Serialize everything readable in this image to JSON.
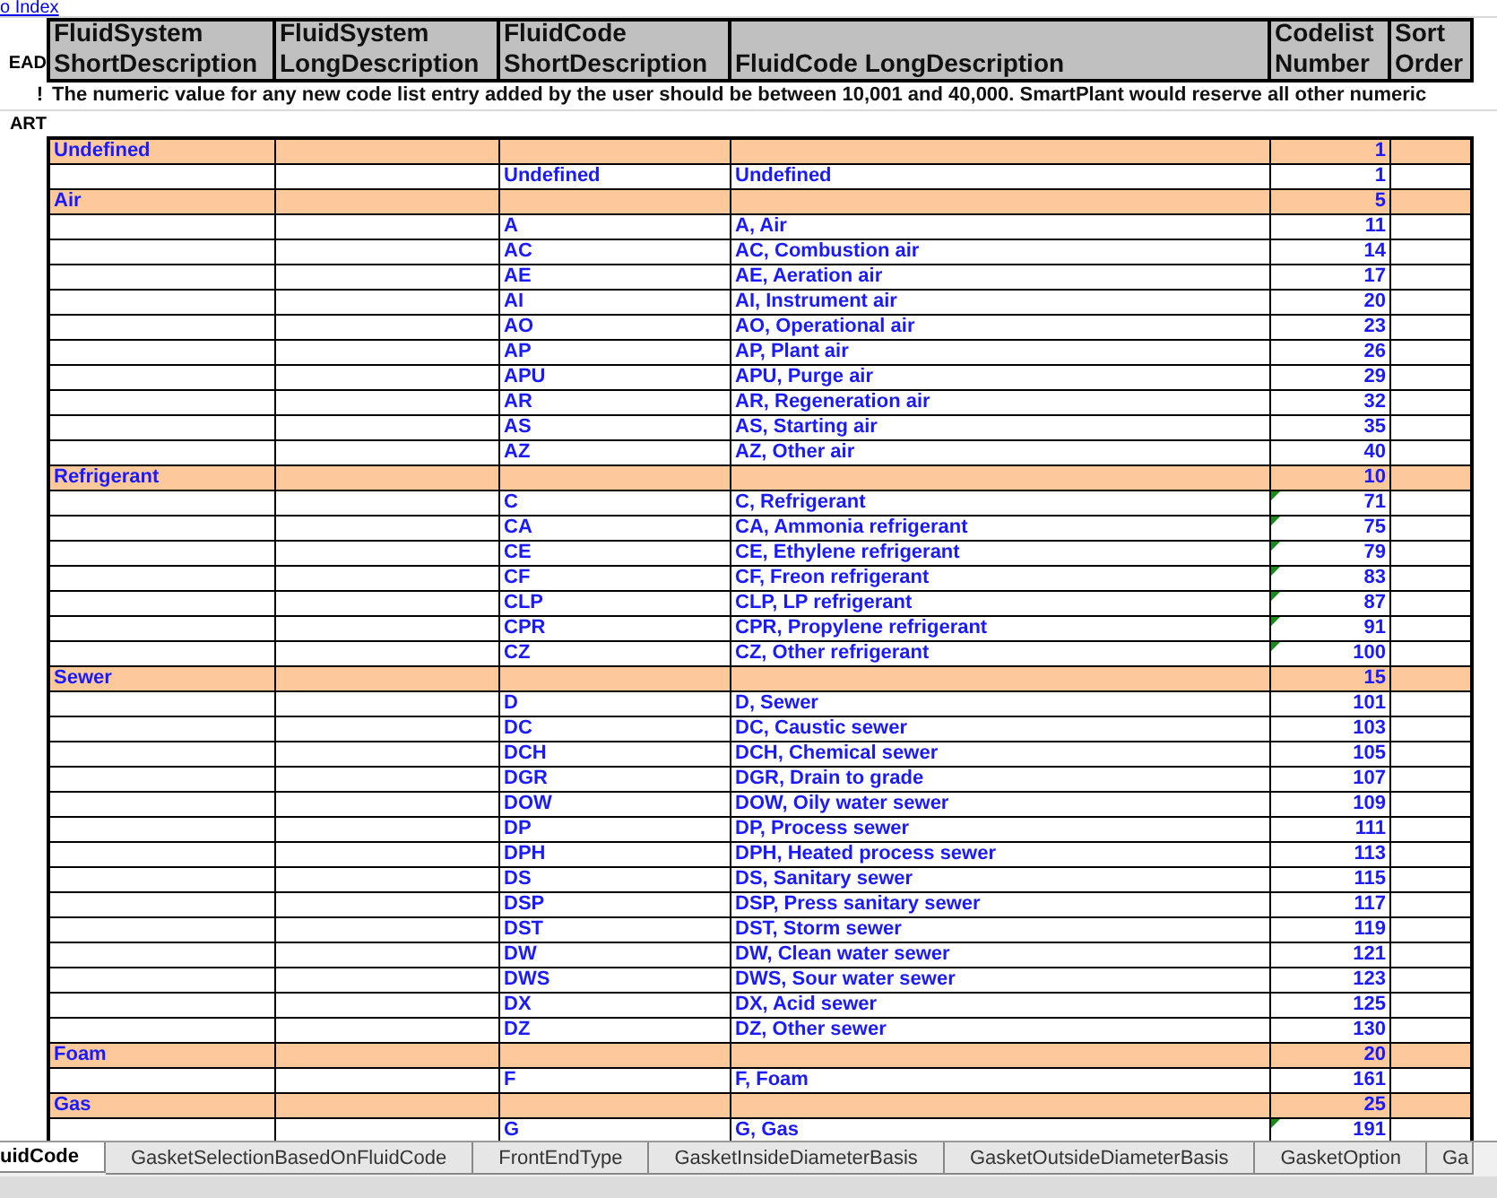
{
  "link": "o Index",
  "row_labels": [
    "EAD",
    "!",
    "ART"
  ],
  "columns": [
    "FluidSystem ShortDescription",
    "FluidSystem LongDescription",
    "FluidCode ShortDescription",
    "FluidCode LongDescription",
    "Codelist Number",
    "Sort Order"
  ],
  "note": "The numeric value for any new code list entry added by the user should be between 10,001 and 40,000. SmartPlant would reserve all other numeric",
  "rows": [
    {
      "kind": "group",
      "name": "Undefined",
      "number": "1"
    },
    {
      "kind": "item",
      "code": "Undefined",
      "description": "Undefined",
      "number": "1",
      "flagged": false
    },
    {
      "kind": "group",
      "name": "Air",
      "number": "5"
    },
    {
      "kind": "item",
      "code": "A",
      "description": "A, Air",
      "number": "11",
      "flagged": false
    },
    {
      "kind": "item",
      "code": "AC",
      "description": "AC, Combustion air",
      "number": "14",
      "flagged": false
    },
    {
      "kind": "item",
      "code": "AE",
      "description": "AE, Aeration air",
      "number": "17",
      "flagged": false
    },
    {
      "kind": "item",
      "code": "AI",
      "description": "AI, Instrument air",
      "number": "20",
      "flagged": false
    },
    {
      "kind": "item",
      "code": "AO",
      "description": "AO, Operational air",
      "number": "23",
      "flagged": false
    },
    {
      "kind": "item",
      "code": "AP",
      "description": "AP, Plant air",
      "number": "26",
      "flagged": false
    },
    {
      "kind": "item",
      "code": "APU",
      "description": "APU, Purge air",
      "number": "29",
      "flagged": false
    },
    {
      "kind": "item",
      "code": "AR",
      "description": "AR, Regeneration air",
      "number": "32",
      "flagged": false
    },
    {
      "kind": "item",
      "code": "AS",
      "description": "AS, Starting air",
      "number": "35",
      "flagged": false
    },
    {
      "kind": "item",
      "code": "AZ",
      "description": "AZ, Other air",
      "number": "40",
      "flagged": false
    },
    {
      "kind": "group",
      "name": "Refrigerant",
      "number": "10"
    },
    {
      "kind": "item",
      "code": "C",
      "description": "C, Refrigerant",
      "number": "71",
      "flagged": true
    },
    {
      "kind": "item",
      "code": "CA",
      "description": "CA, Ammonia refrigerant",
      "number": "75",
      "flagged": true
    },
    {
      "kind": "item",
      "code": "CE",
      "description": "CE, Ethylene refrigerant",
      "number": "79",
      "flagged": true
    },
    {
      "kind": "item",
      "code": "CF",
      "description": "CF, Freon refrigerant",
      "number": "83",
      "flagged": true
    },
    {
      "kind": "item",
      "code": "CLP",
      "description": "CLP, LP refrigerant",
      "number": "87",
      "flagged": true
    },
    {
      "kind": "item",
      "code": "CPR",
      "description": "CPR, Propylene refrigerant",
      "number": "91",
      "flagged": true
    },
    {
      "kind": "item",
      "code": "CZ",
      "description": "CZ, Other refrigerant",
      "number": "100",
      "flagged": true
    },
    {
      "kind": "group",
      "name": "Sewer",
      "number": "15"
    },
    {
      "kind": "item",
      "code": "D",
      "description": "D, Sewer",
      "number": "101",
      "flagged": false
    },
    {
      "kind": "item",
      "code": "DC",
      "description": "DC, Caustic sewer",
      "number": "103",
      "flagged": false
    },
    {
      "kind": "item",
      "code": "DCH",
      "description": "DCH, Chemical sewer",
      "number": "105",
      "flagged": false
    },
    {
      "kind": "item",
      "code": "DGR",
      "description": "DGR, Drain to grade",
      "number": "107",
      "flagged": false
    },
    {
      "kind": "item",
      "code": "DOW",
      "description": "DOW, Oily water sewer",
      "number": "109",
      "flagged": false
    },
    {
      "kind": "item",
      "code": "DP",
      "description": "DP, Process sewer",
      "number": "111",
      "flagged": false
    },
    {
      "kind": "item",
      "code": "DPH",
      "description": "DPH, Heated process sewer",
      "number": "113",
      "flagged": false
    },
    {
      "kind": "item",
      "code": "DS",
      "description": "DS, Sanitary sewer",
      "number": "115",
      "flagged": false
    },
    {
      "kind": "item",
      "code": "DSP",
      "description": "DSP, Press sanitary sewer",
      "number": "117",
      "flagged": false
    },
    {
      "kind": "item",
      "code": "DST",
      "description": "DST, Storm sewer",
      "number": "119",
      "flagged": false
    },
    {
      "kind": "item",
      "code": "DW",
      "description": "DW, Clean water sewer",
      "number": "121",
      "flagged": false
    },
    {
      "kind": "item",
      "code": "DWS",
      "description": "DWS, Sour water sewer",
      "number": "123",
      "flagged": false
    },
    {
      "kind": "item",
      "code": "DX",
      "description": "DX, Acid sewer",
      "number": "125",
      "flagged": false
    },
    {
      "kind": "item",
      "code": "DZ",
      "description": "DZ, Other sewer",
      "number": "130",
      "flagged": false
    },
    {
      "kind": "group",
      "name": "Foam",
      "number": "20"
    },
    {
      "kind": "item",
      "code": "F",
      "description": "F, Foam",
      "number": "161",
      "flagged": false
    },
    {
      "kind": "group",
      "name": "Gas",
      "number": "25"
    },
    {
      "kind": "item",
      "code": "G",
      "description": "G, Gas",
      "number": "191",
      "flagged": true
    }
  ],
  "sheet_tabs": [
    {
      "label": "uidCode",
      "selected": true
    },
    {
      "label": "GasketSelectionBasedOnFluidCode",
      "selected": false
    },
    {
      "label": "FrontEndType",
      "selected": false
    },
    {
      "label": "GasketInsideDiameterBasis",
      "selected": false
    },
    {
      "label": "GasketOutsideDiameterBasis",
      "selected": false
    },
    {
      "label": "GasketOption",
      "selected": false
    },
    {
      "label": "Ga",
      "selected": false
    }
  ]
}
